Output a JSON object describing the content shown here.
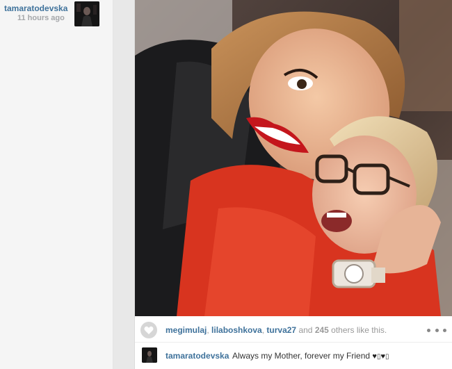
{
  "author": {
    "username": "tamaratodevska",
    "time_ago": "11 hours ago"
  },
  "likes": {
    "likers": [
      "megimulaj",
      "lilaboshkova",
      "turva27"
    ],
    "separator": ", ",
    "connector": " and ",
    "others_count": "245",
    "suffix": " others like this."
  },
  "caption": {
    "username": "tamaratodevska",
    "text": "Always my Mother, forever my Friend",
    "heart_1": "♥",
    "glyph_1": "▯",
    "heart_2": "♥",
    "glyph_2": "▯"
  },
  "icons": {
    "like": "heart-icon",
    "more": "more-options-icon"
  },
  "colors": {
    "username": "#3f729b",
    "meta": "#a5a7aa",
    "text": "#333333"
  }
}
